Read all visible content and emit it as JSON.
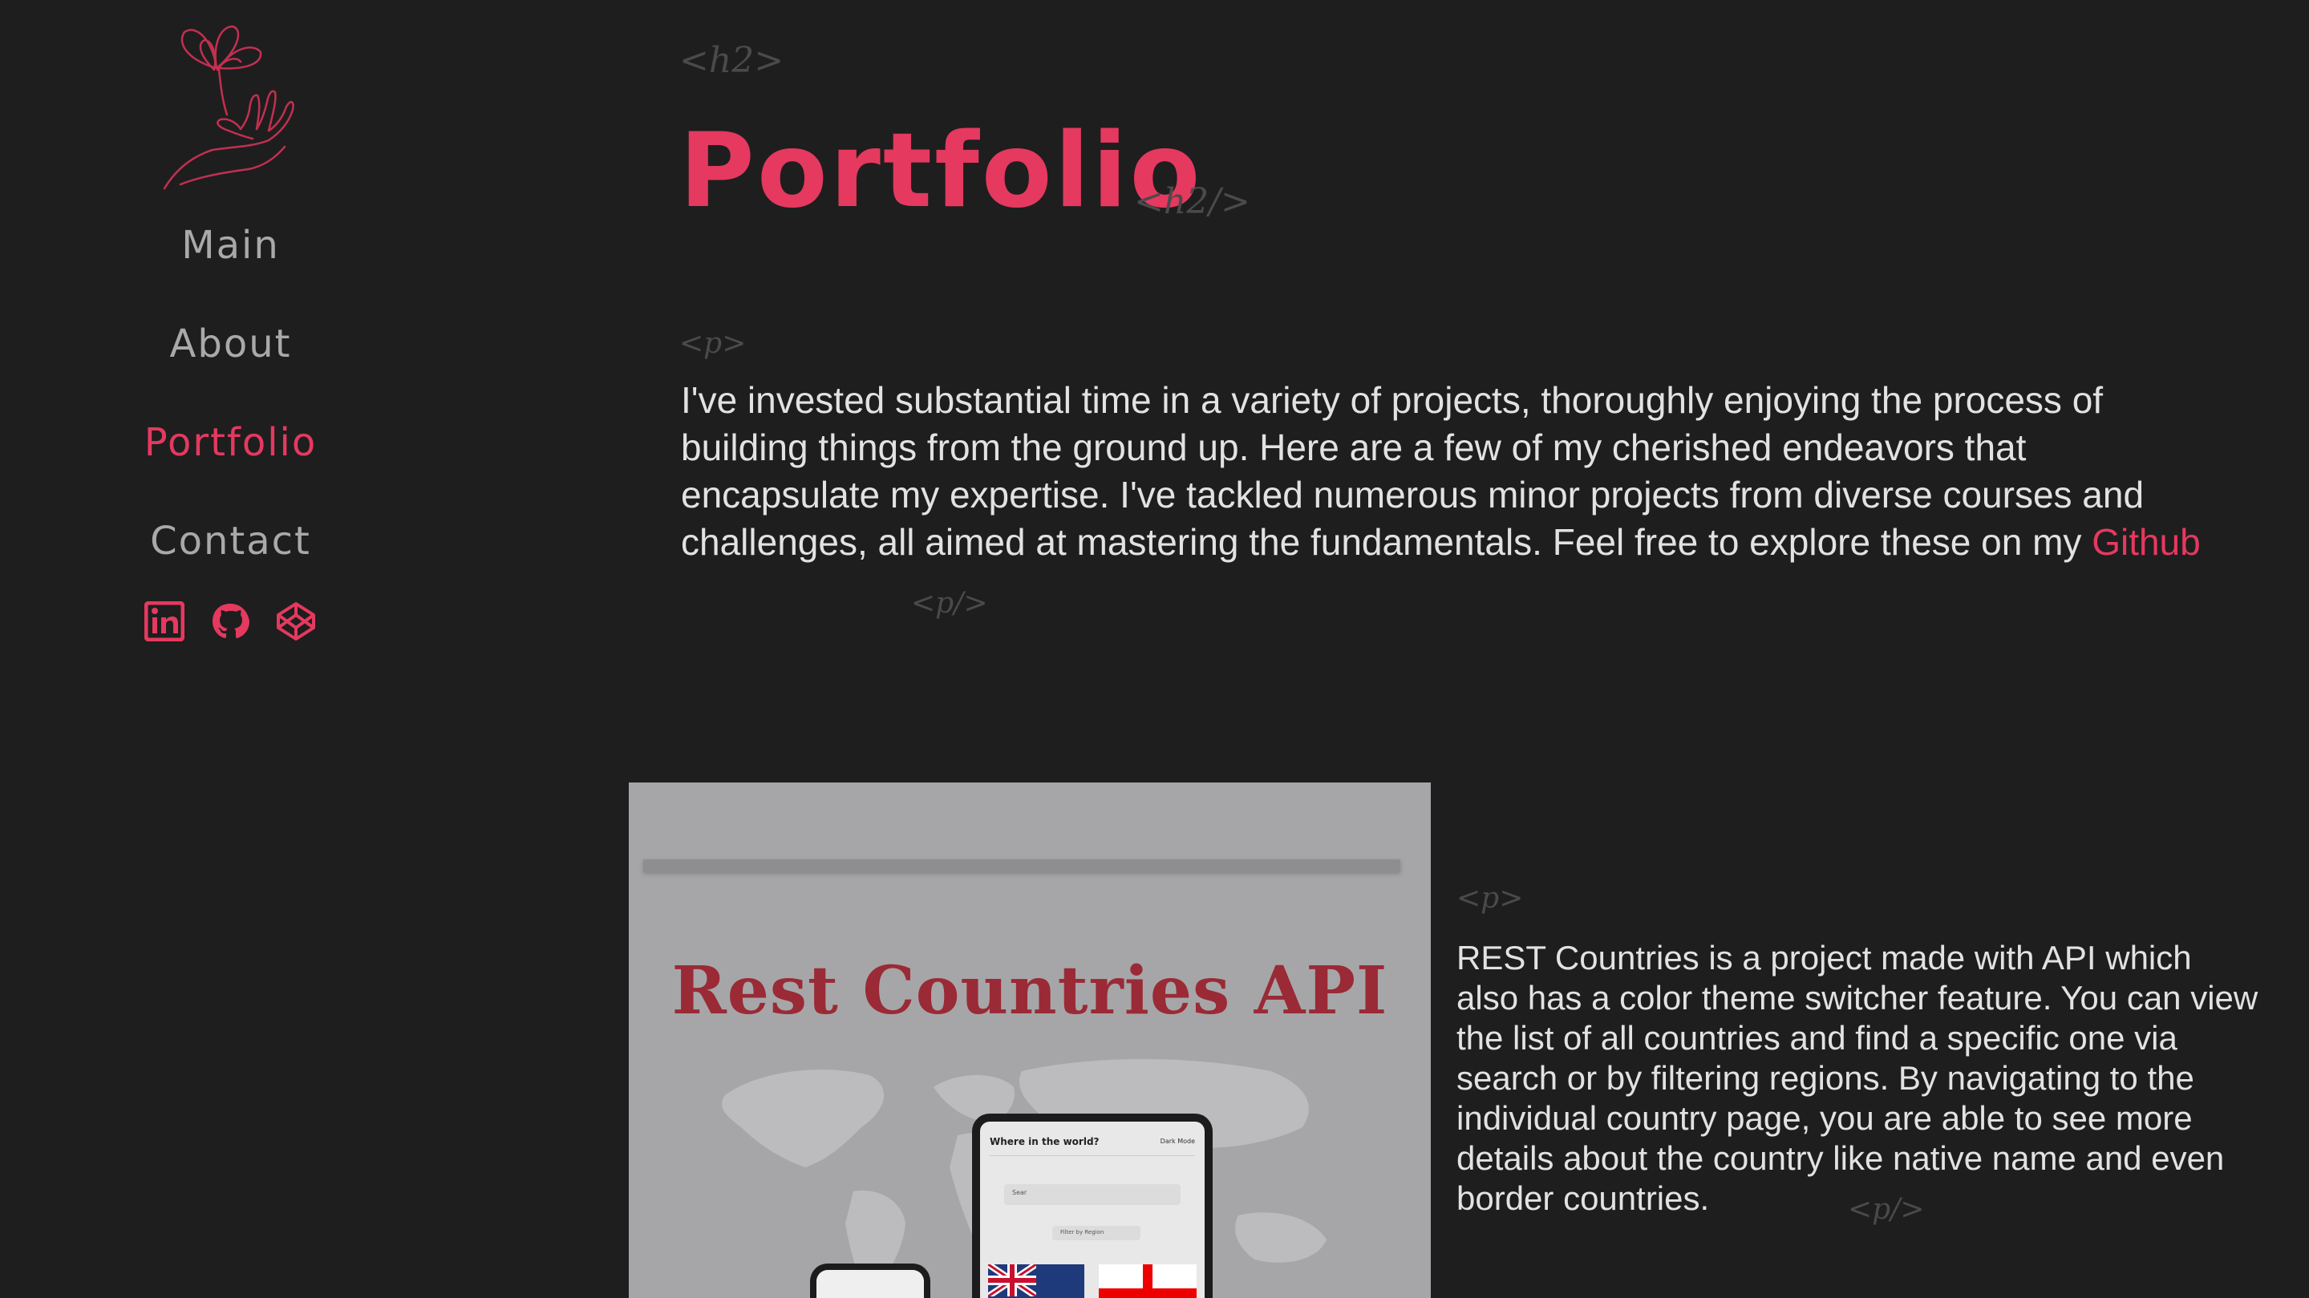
{
  "sidebar": {
    "nav": [
      {
        "label": "Main",
        "active": false
      },
      {
        "label": "About",
        "active": false
      },
      {
        "label": "Portfolio",
        "active": true
      },
      {
        "label": "Contact",
        "active": false
      }
    ],
    "socials": [
      "linkedin-icon",
      "github-icon",
      "codepen-icon"
    ]
  },
  "main": {
    "h2_open": "<h2>",
    "title": "Portfolio",
    "h2_close": "<h2/>",
    "p_open": "<p>",
    "intro_text": "I've invested substantial time in a variety of projects, thoroughly enjoying the process of building things from the ground up. Here are a few of my cherished endeavors that encapsulate my expertise. I've tackled numerous minor projects from diverse courses and challenges, all aimed at mastering the fundamentals. Feel free to explore these on my ",
    "intro_link": "Github",
    "p_close": "<p/>"
  },
  "project": {
    "image_title": "Rest Countries API",
    "p_open": "<p>",
    "description": "REST Countries is a project made with API which also has a color theme switcher feature. You can view the list of all countries and find a specific one via search or by filtering regions. By navigating to the individual country page, you are able to see more details about the country like native name and even border countries.",
    "p_close": "<p/>",
    "mock_app_title": "Where in the world?",
    "mock_dark_mode": "Dark Mode",
    "mock_search": "Sear",
    "mock_filter": "Filter by Region"
  },
  "colors": {
    "accent": "#e5395f",
    "background": "#1e1e1f",
    "nav_text": "#a9a9a9",
    "tag_text": "#4a4a4c"
  }
}
